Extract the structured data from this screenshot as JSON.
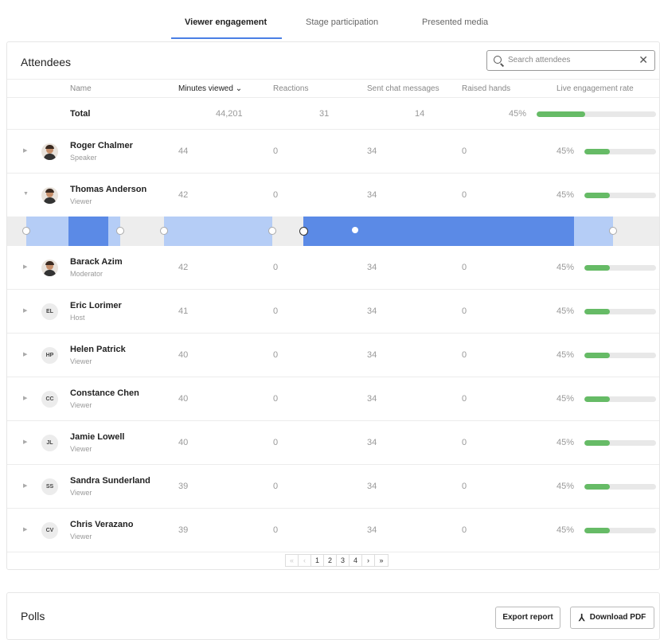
{
  "tabs": [
    {
      "label": "Viewer engagement",
      "active": true
    },
    {
      "label": "Stage participation",
      "active": false
    },
    {
      "label": "Presented media",
      "active": false
    }
  ],
  "attendees": {
    "title": "Attendees",
    "search_placeholder": "Search attendees",
    "close_glyph": "✕",
    "columns": {
      "name": "Name",
      "minutes": "Minutes viewed",
      "sort_glyph": "⌄",
      "reactions": "Reactions",
      "chat": "Sent chat messages",
      "hands": "Raised hands",
      "rate": "Live engagement rate"
    },
    "total": {
      "label": "Total",
      "minutes": "44,201",
      "reactions": "31",
      "chat": "14",
      "rate": "45%",
      "rate_value": 0.45
    },
    "rows": [
      {
        "name": "Roger Chalmer",
        "role": "Speaker",
        "initials": "",
        "photo": true,
        "minutes": "44",
        "reactions": "0",
        "chat": "34",
        "hands": "0",
        "rate": "45%",
        "rate_value": 0.45,
        "expanded": false
      },
      {
        "name": "Thomas Anderson",
        "role": "Viewer",
        "initials": "",
        "photo": true,
        "minutes": "42",
        "reactions": "0",
        "chat": "34",
        "hands": "0",
        "rate": "45%",
        "rate_value": 0.45,
        "expanded": true
      },
      {
        "name": "Barack Azim",
        "role": "Moderator",
        "initials": "",
        "photo": true,
        "minutes": "42",
        "reactions": "0",
        "chat": "34",
        "hands": "0",
        "rate": "45%",
        "rate_value": 0.45,
        "expanded": false
      },
      {
        "name": "Eric Lorimer",
        "role": "Host",
        "initials": "EL",
        "photo": false,
        "minutes": "41",
        "reactions": "0",
        "chat": "34",
        "hands": "0",
        "rate": "45%",
        "rate_value": 0.45,
        "expanded": false
      },
      {
        "name": "Helen Patrick",
        "role": "Viewer",
        "initials": "HP",
        "photo": false,
        "minutes": "40",
        "reactions": "0",
        "chat": "34",
        "hands": "0",
        "rate": "45%",
        "rate_value": 0.45,
        "expanded": false
      },
      {
        "name": "Constance Chen",
        "role": "Viewer",
        "initials": "CC",
        "photo": false,
        "minutes": "40",
        "reactions": "0",
        "chat": "34",
        "hands": "0",
        "rate": "45%",
        "rate_value": 0.45,
        "expanded": false
      },
      {
        "name": "Jamie Lowell",
        "role": "Viewer",
        "initials": "JL",
        "photo": false,
        "minutes": "40",
        "reactions": "0",
        "chat": "34",
        "hands": "0",
        "rate": "45%",
        "rate_value": 0.45,
        "expanded": false
      },
      {
        "name": "Sandra Sunderland",
        "role": "Viewer",
        "initials": "SS",
        "photo": false,
        "minutes": "39",
        "reactions": "0",
        "chat": "34",
        "hands": "0",
        "rate": "45%",
        "rate_value": 0.45,
        "expanded": false
      },
      {
        "name": "Chris Verazano",
        "role": "Viewer",
        "initials": "CV",
        "photo": false,
        "minutes": "39",
        "reactions": "0",
        "chat": "34",
        "hands": "0",
        "rate": "45%",
        "rate_value": 0.45,
        "expanded": false
      }
    ],
    "pagination": {
      "buttons": [
        "«",
        "‹",
        "1",
        "2",
        "3",
        "4",
        "›",
        "»"
      ],
      "current_page": "1"
    }
  },
  "polls": {
    "title": "Polls",
    "export_label": "Export report",
    "download_label": "Download PDF"
  },
  "colors": {
    "accent": "#4a7fe5",
    "engagement_bar": "#66bb66",
    "timeline_strong": "#5b8ae6",
    "timeline_light": "#b5cdf6"
  }
}
